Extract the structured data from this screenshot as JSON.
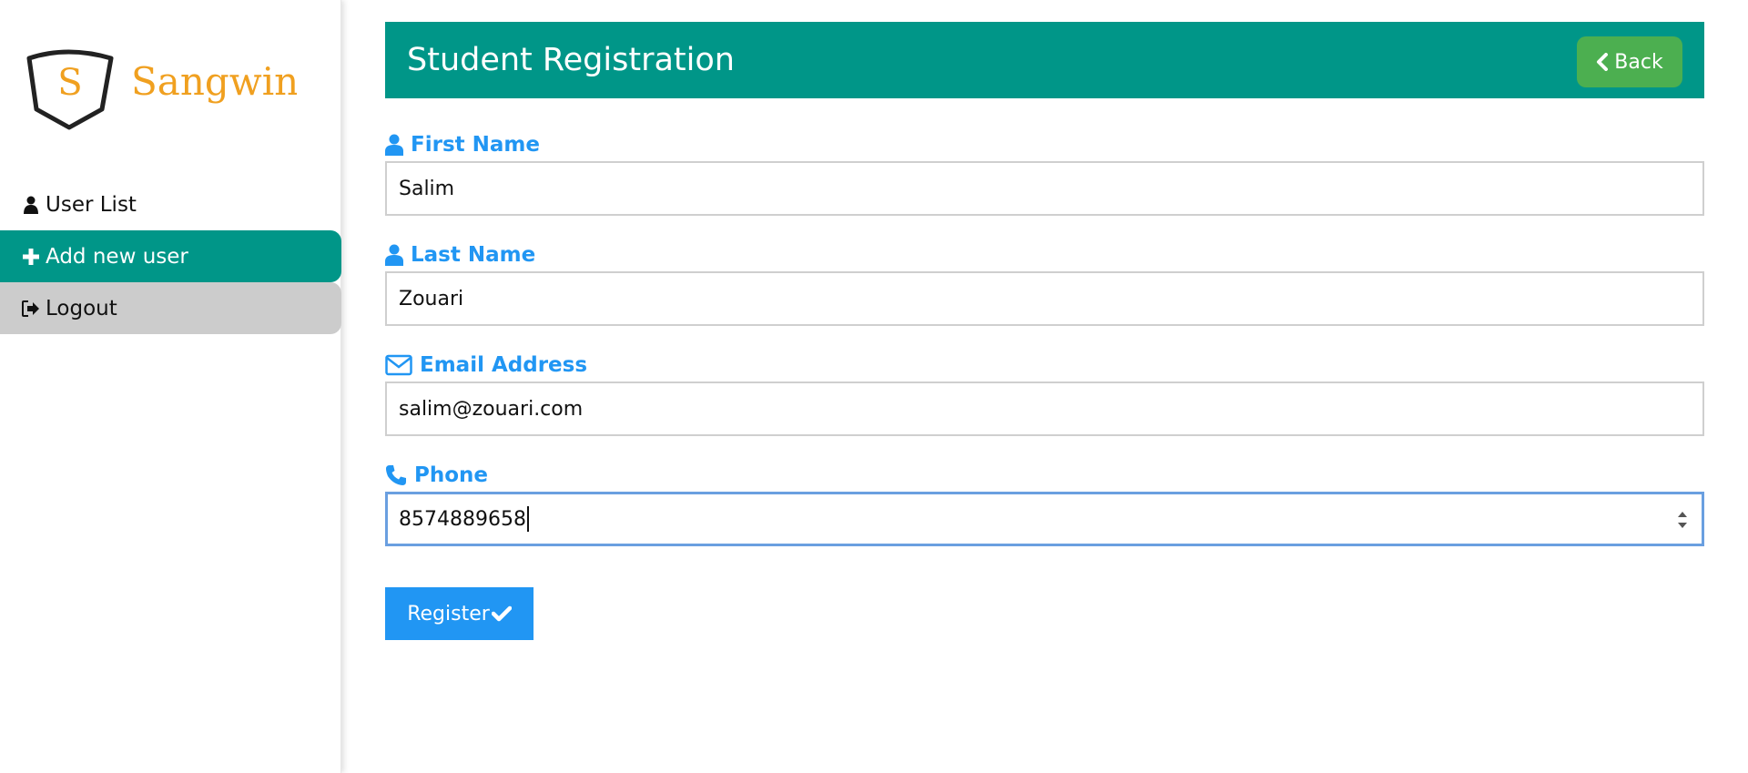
{
  "brand": {
    "logo_letter": "S",
    "logo_text": "Sangwin",
    "color": "#f0a020"
  },
  "sidebar": {
    "items": [
      {
        "label": "User List",
        "icon": "user-icon"
      },
      {
        "label": "Add new user",
        "icon": "plus-icon",
        "active": true
      },
      {
        "label": "Logout",
        "icon": "logout-icon"
      }
    ]
  },
  "header": {
    "title": "Student Registration",
    "back_label": "Back",
    "back_icon": "chevron-left-icon"
  },
  "form": {
    "first_name": {
      "label": "First Name",
      "value": "Salim",
      "icon": "user-icon"
    },
    "last_name": {
      "label": "Last Name",
      "value": "Zouari",
      "icon": "user-icon"
    },
    "email": {
      "label": "Email Address",
      "value": "salim@zouari.com",
      "icon": "envelope-icon"
    },
    "phone": {
      "label": "Phone",
      "value": "8574889658",
      "icon": "phone-icon"
    },
    "register_label": "Register"
  },
  "colors": {
    "accent": "#009688",
    "primary": "#2196f3",
    "success": "#4caf50",
    "muted": "#cccccc"
  }
}
